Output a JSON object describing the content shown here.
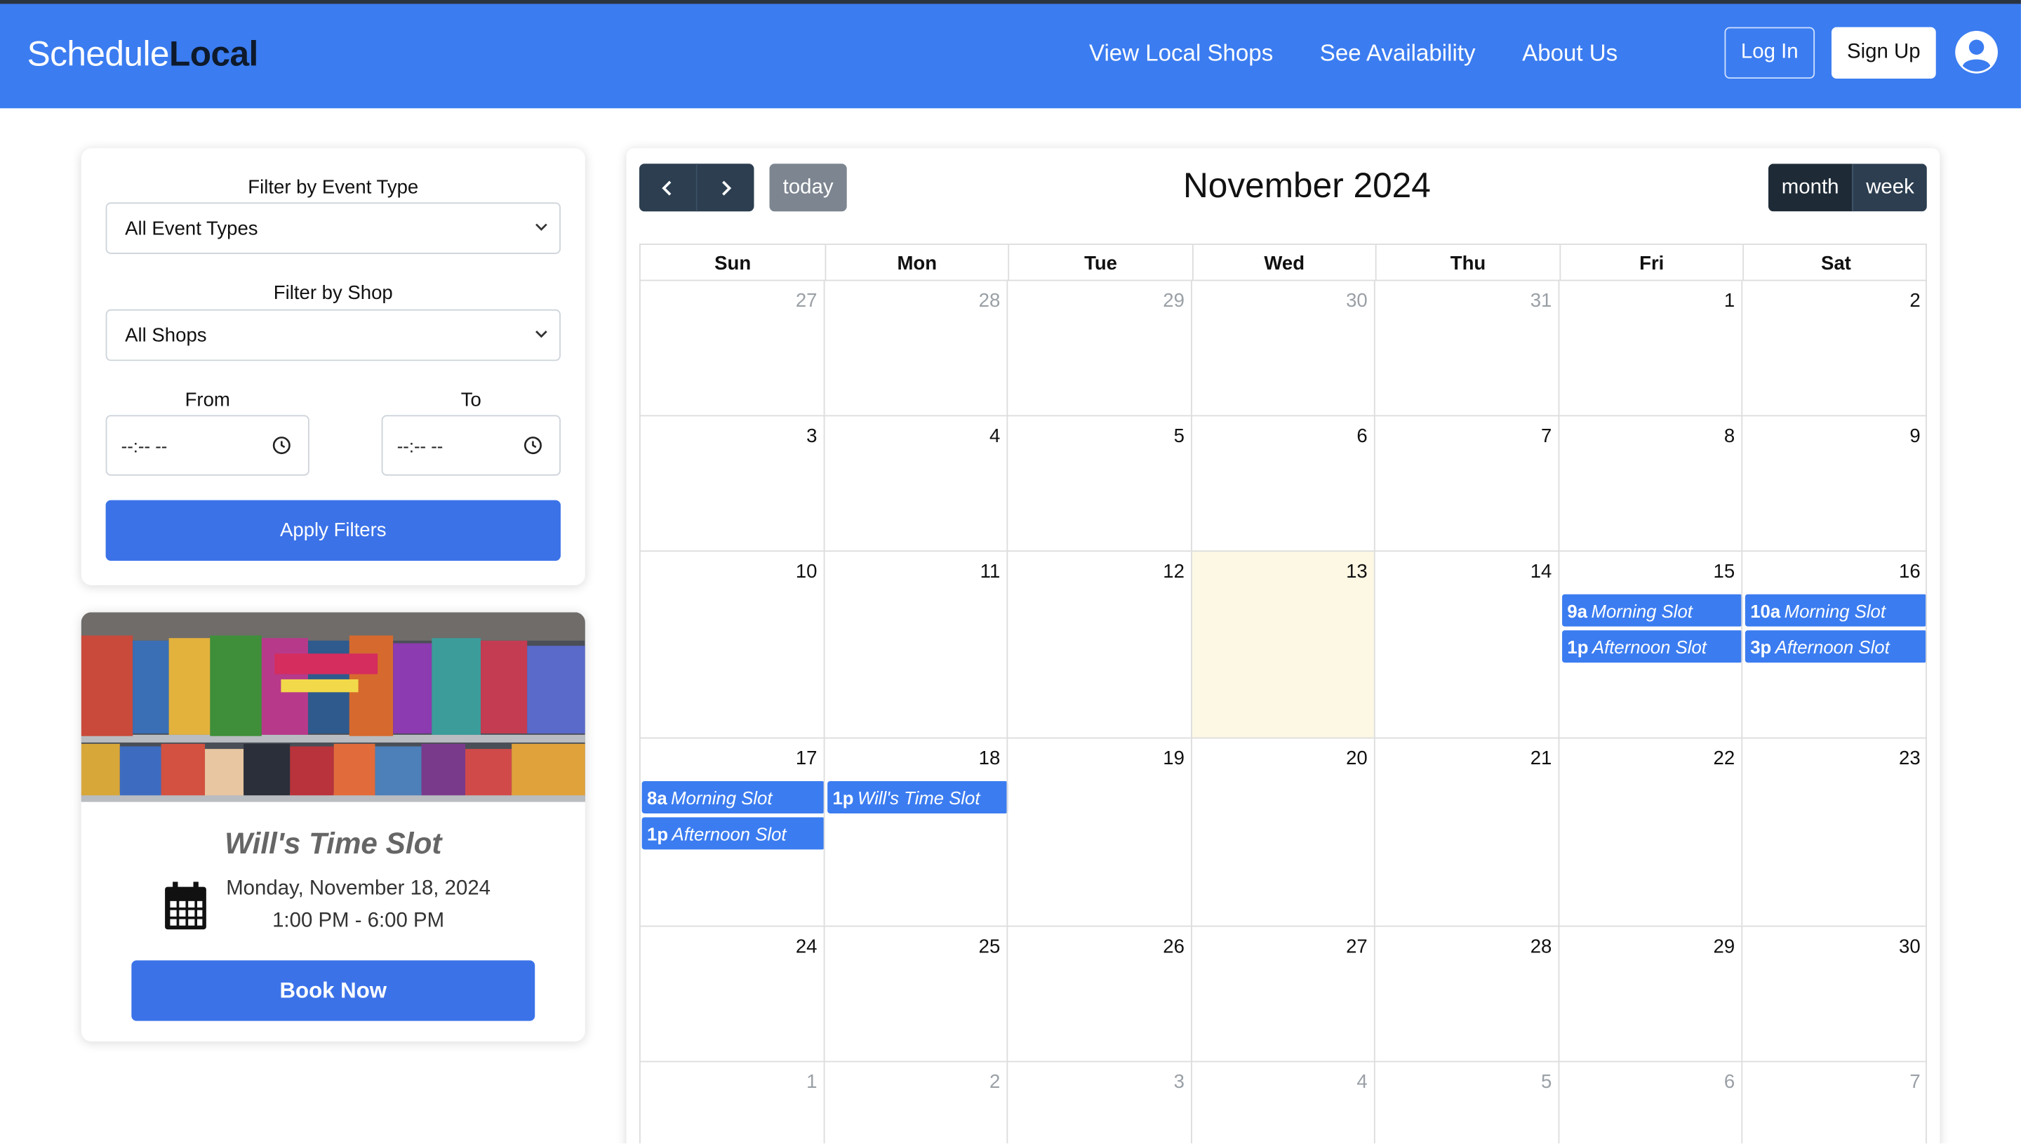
{
  "header": {
    "brand_part1": "Schedule",
    "brand_part2": "Local",
    "nav": [
      "View Local Shops",
      "See Availability",
      "About Us"
    ],
    "login": "Log In",
    "signup": "Sign Up",
    "avatar_icon": "user-circle-icon"
  },
  "filters": {
    "event_type_label": "Filter by Event Type",
    "event_type_value": "All Event Types",
    "shop_label": "Filter by Shop",
    "shop_value": "All Shops",
    "from_label": "From",
    "to_label": "To",
    "from_value": "--:-- --",
    "to_value": "--:-- --",
    "apply": "Apply Filters"
  },
  "event_card": {
    "title": "Will's Time Slot",
    "date": "Monday, November 18, 2024",
    "time": "1:00 PM - 6:00 PM",
    "book": "Book Now",
    "image_desc_icon": "comic-shelf-image"
  },
  "calendar": {
    "title": "November 2024",
    "today": "today",
    "views": {
      "month": "month",
      "week": "week"
    },
    "dow": [
      "Sun",
      "Mon",
      "Tue",
      "Wed",
      "Thu",
      "Fri",
      "Sat"
    ],
    "weeks": [
      [
        {
          "d": "27",
          "o": true
        },
        {
          "d": "28",
          "o": true
        },
        {
          "d": "29",
          "o": true
        },
        {
          "d": "30",
          "o": true
        },
        {
          "d": "31",
          "o": true
        },
        {
          "d": "1"
        },
        {
          "d": "2"
        }
      ],
      [
        {
          "d": "3"
        },
        {
          "d": "4"
        },
        {
          "d": "5"
        },
        {
          "d": "6"
        },
        {
          "d": "7"
        },
        {
          "d": "8"
        },
        {
          "d": "9"
        }
      ],
      [
        {
          "d": "10"
        },
        {
          "d": "11"
        },
        {
          "d": "12"
        },
        {
          "d": "13",
          "today": true
        },
        {
          "d": "14"
        },
        {
          "d": "15",
          "events": [
            {
              "t": "9a",
              "n": "Morning Slot"
            },
            {
              "t": "1p",
              "n": "Afternoon Slot"
            }
          ]
        },
        {
          "d": "16",
          "events": [
            {
              "t": "10a",
              "n": "Morning Slot"
            },
            {
              "t": "3p",
              "n": "Afternoon Slot"
            }
          ]
        }
      ],
      [
        {
          "d": "17",
          "events": [
            {
              "t": "8a",
              "n": "Morning Slot"
            },
            {
              "t": "1p",
              "n": "Afternoon Slot"
            }
          ]
        },
        {
          "d": "18",
          "events": [
            {
              "t": "1p",
              "n": "Will's Time Slot"
            }
          ]
        },
        {
          "d": "19"
        },
        {
          "d": "20"
        },
        {
          "d": "21"
        },
        {
          "d": "22"
        },
        {
          "d": "23"
        }
      ],
      [
        {
          "d": "24"
        },
        {
          "d": "25"
        },
        {
          "d": "26"
        },
        {
          "d": "27"
        },
        {
          "d": "28"
        },
        {
          "d": "29"
        },
        {
          "d": "30"
        }
      ],
      [
        {
          "d": "1",
          "o": true
        },
        {
          "d": "2",
          "o": true
        },
        {
          "d": "3",
          "o": true
        },
        {
          "d": "4",
          "o": true
        },
        {
          "d": "5",
          "o": true
        },
        {
          "d": "6",
          "o": true
        },
        {
          "d": "7",
          "o": true
        }
      ]
    ]
  },
  "colors": {
    "navbar": "#3b7cf0",
    "primary_button": "#3b72e8",
    "event": "#3b7cf0",
    "today_bg": "#fdf8e4",
    "dark_button": "#2c3e50"
  }
}
